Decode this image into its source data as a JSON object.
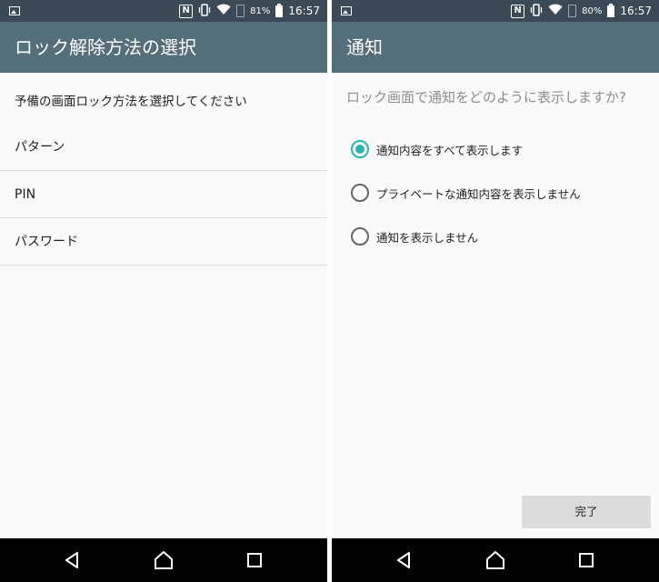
{
  "left": {
    "status": {
      "battery_pct": "81%",
      "time": "16:57",
      "nfc": "N"
    },
    "appbar_title": "ロック解除方法の選択",
    "subheading": "予備の画面ロック方法を選択してください",
    "items": [
      {
        "label": "パターン"
      },
      {
        "label": "PIN"
      },
      {
        "label": "パスワード"
      }
    ]
  },
  "right": {
    "status": {
      "battery_pct": "80%",
      "time": "16:57",
      "nfc": "N"
    },
    "appbar_title": "通知",
    "question": "ロック画面で通知をどのように表示しますか?",
    "options": [
      {
        "label": "通知内容をすべて表示します",
        "selected": true
      },
      {
        "label": "プライベートな通知内容を表示しません",
        "selected": false
      },
      {
        "label": "通知を表示しません",
        "selected": false
      }
    ],
    "done_label": "完了"
  },
  "colors": {
    "statusbar": "#3a4a57",
    "appbar": "#546e7a",
    "accent": "#26b5b2",
    "navbar": "#000000"
  },
  "icons": {
    "nav": [
      "back-triangle-icon",
      "home-icon",
      "recent-apps-icon"
    ],
    "status": [
      "image-notification-icon",
      "nfc-icon",
      "vibrate-icon",
      "wifi-icon",
      "battery-icon"
    ]
  }
}
